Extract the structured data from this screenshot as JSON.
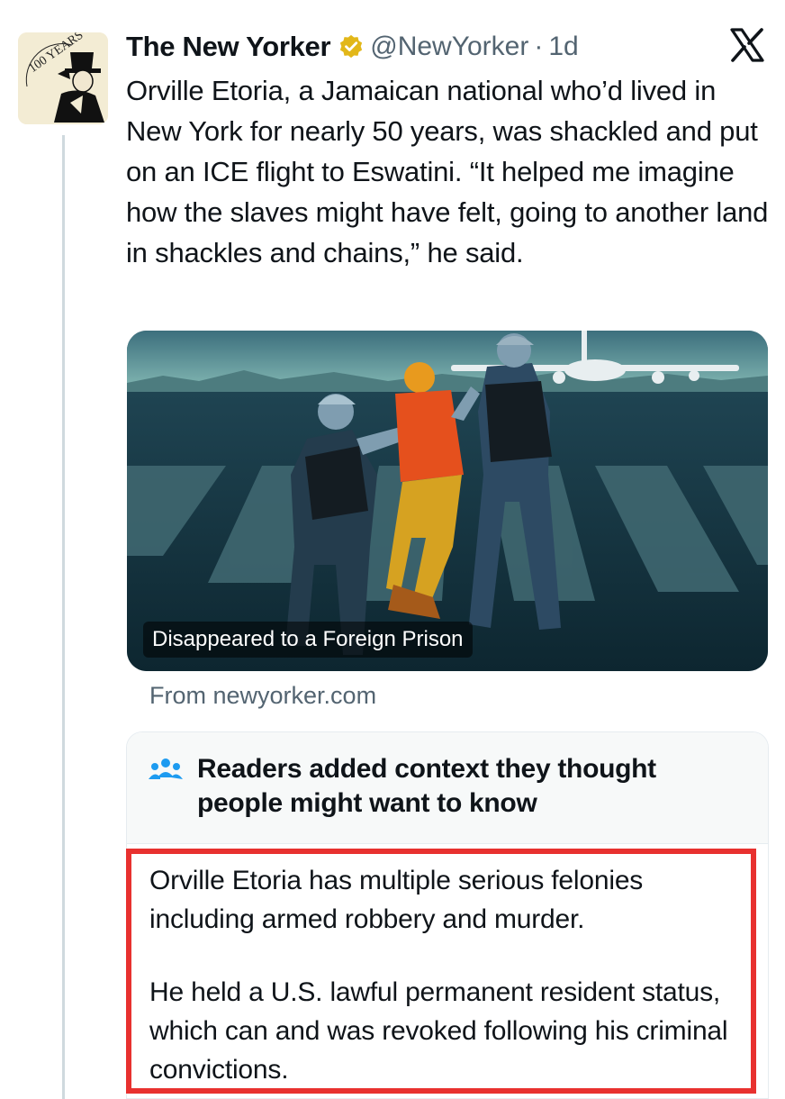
{
  "tweet": {
    "author_name": "The New Yorker",
    "handle": "@NewYorker",
    "separator": "·",
    "time": "1d",
    "avatar_text": "100 YEARS",
    "text": "Orville Etoria, a Jamaican national who’d lived in New York for nearly 50 years, was shackled and put on an ICE flight to Eswatini. “It helped me imagine how the slaves might have felt, going to another land in shackles and chains,” he said.",
    "media_caption": "Disappeared to a Foreign Prison",
    "source": "From newyorker.com"
  },
  "community_note": {
    "title": "Readers added context they thought people might want to know",
    "paragraphs": [
      "Orville Etoria has multiple serious felonies including armed robbery and murder.",
      "He held a U.S. lawful permanent resident status, which can and was revoked following his criminal convictions."
    ]
  },
  "icons": {
    "verified": "verified-badge-icon",
    "platform": "x-logo-icon",
    "note": "people-icon"
  },
  "colors": {
    "verified_gold": "#e2b719",
    "highlight_red": "#e8312f",
    "secondary_text": "#536471"
  }
}
